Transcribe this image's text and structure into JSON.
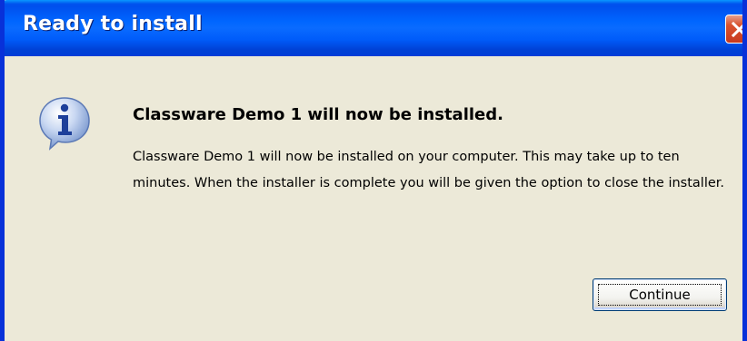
{
  "window": {
    "title": "Ready to install",
    "close_icon": "close-icon"
  },
  "dialog": {
    "icon": "info-icon",
    "heading": "Classware Demo 1 will now be installed.",
    "message": "Classware Demo 1 will now be installed on your computer. This may take up to ten minutes. When the installer is complete you will be given the option to close the installer.",
    "continue_label": "Continue"
  },
  "colors": {
    "titlebar": "#0054e3",
    "frame": "#0831d9",
    "dialog_bg": "#ece9d8",
    "close_button": "#d9532f"
  }
}
